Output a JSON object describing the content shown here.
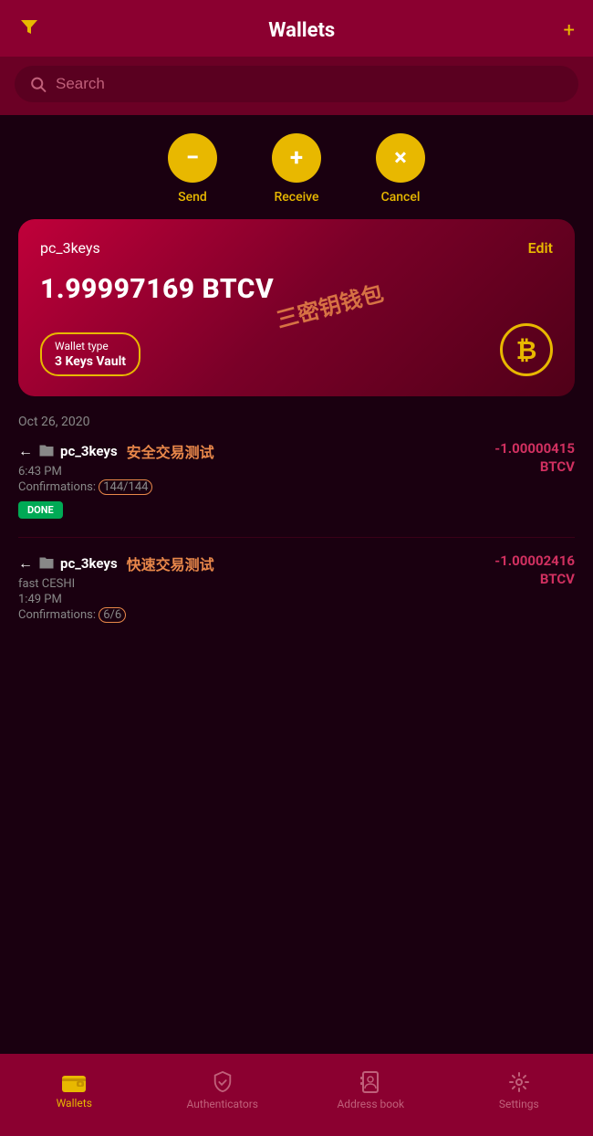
{
  "header": {
    "title": "Wallets",
    "filter_icon": "▼",
    "add_icon": "+"
  },
  "search": {
    "placeholder": "Search"
  },
  "actions": [
    {
      "id": "send",
      "icon": "−",
      "label": "Send"
    },
    {
      "id": "receive",
      "icon": "+",
      "label": "Receive"
    },
    {
      "id": "cancel",
      "icon": "×",
      "label": "Cancel"
    }
  ],
  "wallet_card": {
    "name": "pc_3keys",
    "edit_label": "Edit",
    "balance": "1.99997169 BTCV",
    "type_label": "Wallet type",
    "type_value": "3 Keys Vault",
    "btc_symbol": "₿",
    "watermark": "三密钥钱包"
  },
  "transactions": {
    "date": "Oct 26, 2020",
    "items": [
      {
        "arrow": "←",
        "wallet_icon": "🗂",
        "wallet_name": "pc_3keys",
        "chinese_label": "安全交易测试",
        "time": "6:43 PM",
        "confirmations": "Confirmations: 144/144",
        "status": "DONE",
        "amount_line1": "-1.00000415",
        "amount_line2": "BTCV"
      },
      {
        "arrow": "←",
        "wallet_icon": "🗂",
        "wallet_name": "pc_3keys",
        "extra_label": "fast CESHI",
        "chinese_label": "快速交易测试",
        "time": "1:49 PM",
        "confirmations": "Confirmations: 6/6",
        "status": "",
        "amount_line1": "-1.00002416",
        "amount_line2": "BTCV"
      }
    ]
  },
  "bottom_nav": {
    "items": [
      {
        "id": "wallets",
        "icon": "wallet",
        "label": "Wallets",
        "active": true
      },
      {
        "id": "authenticators",
        "icon": "shield",
        "label": "Authenticators",
        "active": false
      },
      {
        "id": "address-book",
        "icon": "book",
        "label": "Address book",
        "active": false
      },
      {
        "id": "settings",
        "icon": "gear",
        "label": "Settings",
        "active": false
      }
    ]
  }
}
